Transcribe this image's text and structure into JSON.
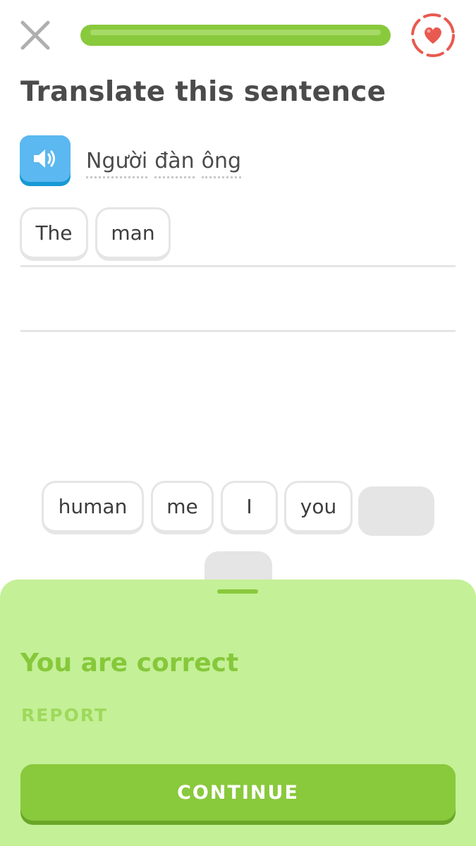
{
  "header": {
    "close_icon": "close-icon",
    "progress": 1.0,
    "hearts_icon": "heart-icon"
  },
  "title": "Translate this sentence",
  "prompt": {
    "speaker_icon": "speaker-icon",
    "words": [
      "Người",
      "đàn",
      "ông"
    ]
  },
  "answer": {
    "words": [
      "The",
      "man"
    ]
  },
  "word_bank": {
    "words": [
      "human",
      "me",
      "I",
      "you"
    ]
  },
  "feedback": {
    "title": "You are correct",
    "report_label": "REPORT",
    "continue_label": "CONTINUE"
  },
  "colors": {
    "accent_green": "#89c93c",
    "sheet_green": "#c4f097",
    "speaker_blue": "#5bb8f0",
    "heart_red": "#e85a4f"
  }
}
